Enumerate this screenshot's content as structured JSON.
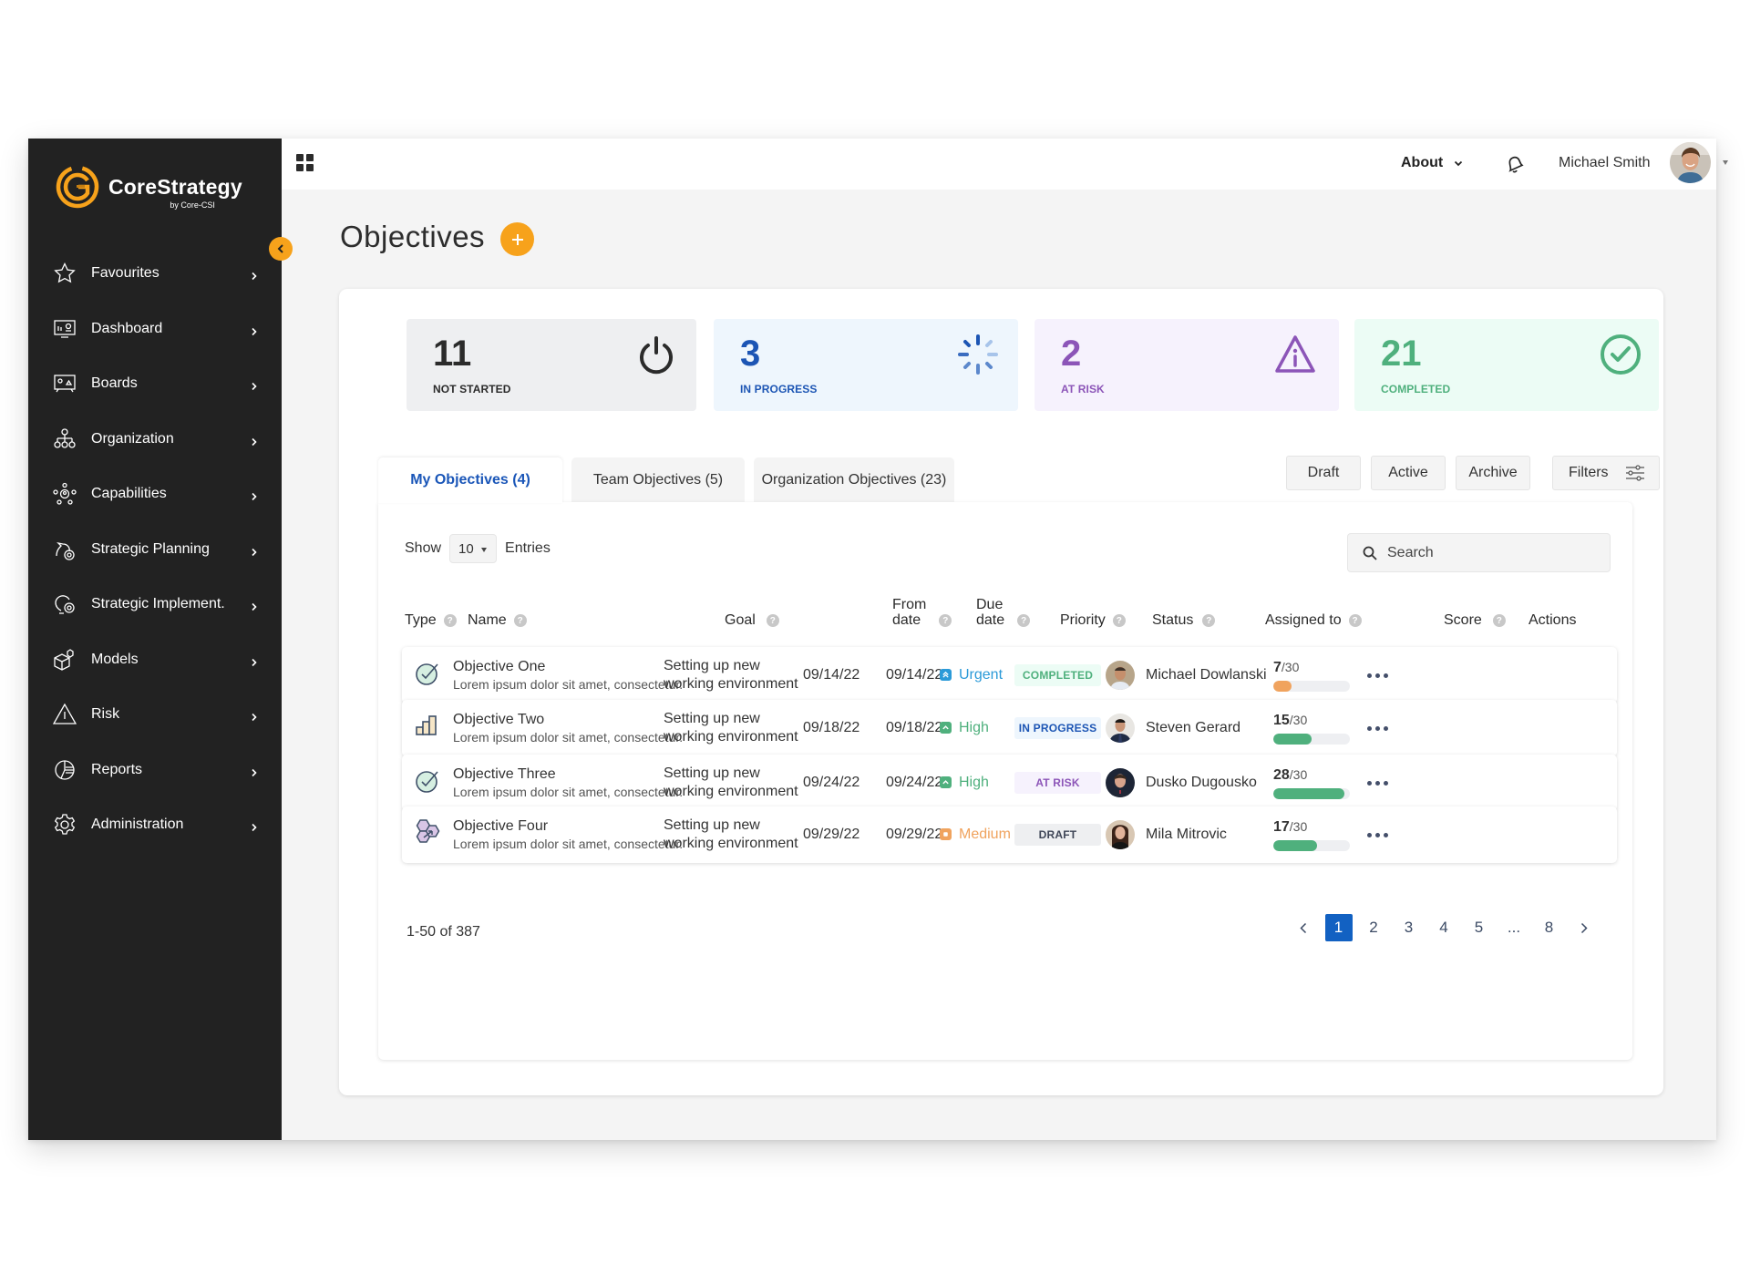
{
  "brand": {
    "name": "CoreStrategy",
    "sub": "by Core-CSI",
    "accent": "#f7a21b"
  },
  "sidebar": {
    "items": [
      {
        "label": "Favourites",
        "icon": "star-icon"
      },
      {
        "label": "Dashboard",
        "icon": "dashboard-icon"
      },
      {
        "label": "Boards",
        "icon": "boards-icon"
      },
      {
        "label": "Organization",
        "icon": "organization-icon"
      },
      {
        "label": "Capabilities",
        "icon": "capabilities-icon"
      },
      {
        "label": "Strategic Planning",
        "icon": "strategic-planning-icon"
      },
      {
        "label": "Strategic Implement.",
        "icon": "strategic-implement-icon"
      },
      {
        "label": "Models",
        "icon": "models-icon"
      },
      {
        "label": "Risk",
        "icon": "risk-icon"
      },
      {
        "label": "Reports",
        "icon": "reports-icon"
      },
      {
        "label": "Administration",
        "icon": "gear-icon"
      }
    ]
  },
  "topbar": {
    "about": "About",
    "user_name": "Michael Smith"
  },
  "page": {
    "title": "Objectives"
  },
  "stats": [
    {
      "value": "11",
      "label": "NOT STARTED",
      "color": "#2b2b2b",
      "bg": "#eeeff1"
    },
    {
      "value": "3",
      "label": "IN PROGRESS",
      "color": "#1c55b4",
      "bg": "#eef6fd"
    },
    {
      "value": "2",
      "label": "AT RISK",
      "color": "#8c55b8",
      "bg": "#f6f2fd"
    },
    {
      "value": "21",
      "label": "COMPLETED",
      "color": "#4fb07d",
      "bg": "#ecfcf5"
    }
  ],
  "tabs": [
    {
      "label": "My Objectives (4)",
      "active": true
    },
    {
      "label": "Team Objectives (5)",
      "active": false
    },
    {
      "label": "Organization Objectives (23)",
      "active": false
    }
  ],
  "filters": {
    "draft": "Draft",
    "active": "Active",
    "archive": "Archive",
    "filters": "Filters"
  },
  "table": {
    "show_label": "Show",
    "entries_value": "10",
    "entries_label": "Entries",
    "search_placeholder": "Search",
    "columns": {
      "type": "Type",
      "name": "Name",
      "goal": "Goal",
      "from_l1": "From",
      "from_l2": "date",
      "due_l1": "Due",
      "due_l2": "date",
      "priority": "Priority",
      "status": "Status",
      "assigned": "Assigned to",
      "score": "Score",
      "actions": "Actions"
    },
    "rows": [
      {
        "type_icon": "check-circle-icon",
        "name": "Objective One",
        "desc": "Lorem ipsum dolor sit amet, consectetur.",
        "goal_l1": "Setting up new",
        "goal_l2": "working environment",
        "from": "09/14/22",
        "due": "09/14/22",
        "priority": "Urgent",
        "priority_color": "#2b9ad8",
        "status": "COMPLETED",
        "status_color": "#4fb07d",
        "status_bg": "#ecfcf5",
        "assignee": "Michael Dowlanski",
        "score": "7",
        "score_max": "/30",
        "score_pct": 23.3,
        "score_color": "#f0a35e"
      },
      {
        "type_icon": "bar-chart-icon",
        "name": "Objective Two",
        "desc": "Lorem ipsum dolor sit amet, consectetur.",
        "goal_l1": "Setting up new",
        "goal_l2": "working environment",
        "from": "09/18/22",
        "due": "09/18/22",
        "priority": "High",
        "priority_color": "#4fb07d",
        "status": "IN PROGRESS",
        "status_color": "#1c55b4",
        "status_bg": "#eef6fd",
        "assignee": "Steven Gerard",
        "score": "15",
        "score_max": "/30",
        "score_pct": 50,
        "score_color": "#4fb07d"
      },
      {
        "type_icon": "check-circle-icon",
        "name": "Objective Three",
        "desc": "Lorem ipsum dolor sit amet, consectetur.",
        "goal_l1": "Setting up new",
        "goal_l2": "working environment",
        "from": "09/24/22",
        "due": "09/24/22",
        "priority": "High",
        "priority_color": "#4fb07d",
        "status": "AT RISK",
        "status_color": "#8c55b8",
        "status_bg": "#f6f2fd",
        "assignee": "Dusko Dugousko",
        "score": "28",
        "score_max": "/30",
        "score_pct": 93.3,
        "score_color": "#4fb07d"
      },
      {
        "type_icon": "hexagons-icon",
        "name": "Objective Four",
        "desc": "Lorem ipsum dolor sit amet, consectetur.",
        "goal_l1": "Setting up new",
        "goal_l2": "working environment",
        "from": "09/29/22",
        "due": "09/29/22",
        "priority": "Medium",
        "priority_color": "#f0a35e",
        "status": "DRAFT",
        "status_color": "#3f4657",
        "status_bg": "#eeeff1",
        "assignee": "Mila Mitrovic",
        "score": "17",
        "score_max": "/30",
        "score_pct": 56.7,
        "score_color": "#4fb07d"
      }
    ]
  },
  "pagination": {
    "range": "1-50 of 387",
    "pages": [
      "1",
      "2",
      "3",
      "4",
      "5",
      "...",
      "8"
    ],
    "current": "1"
  }
}
